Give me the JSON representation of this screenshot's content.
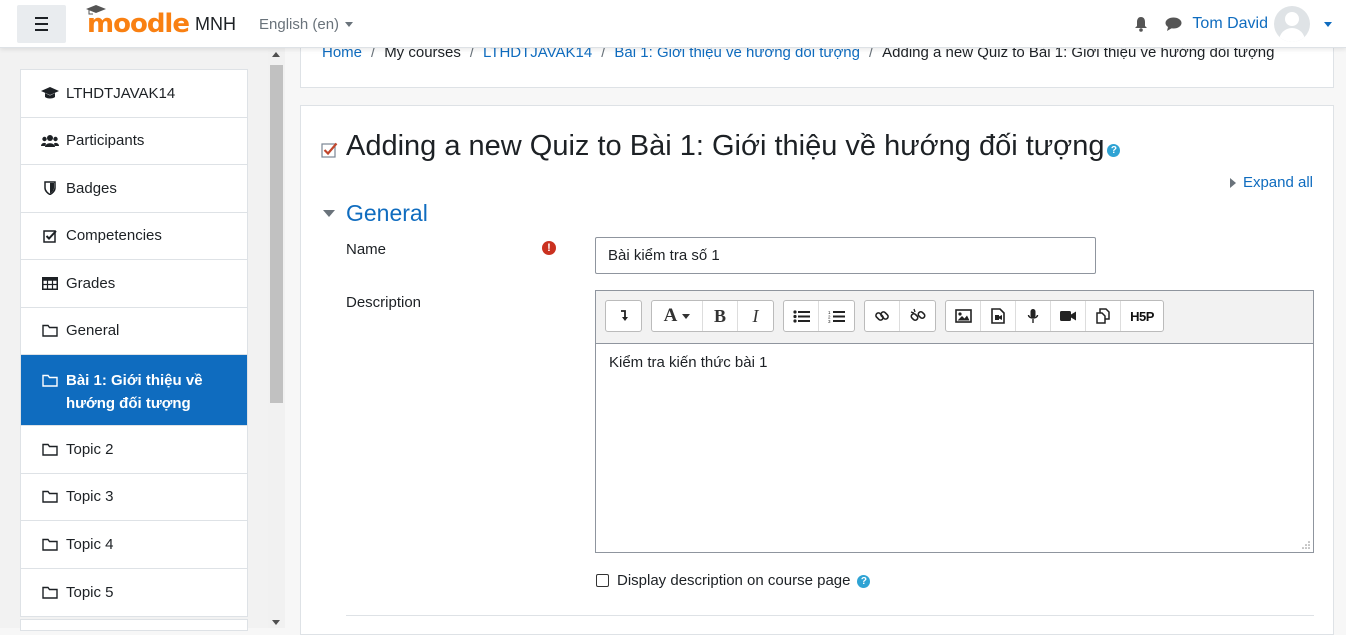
{
  "navbar": {
    "logo_text": "moodle",
    "site_name": "MNH",
    "language": "English (en)",
    "user_name": "Tom David"
  },
  "sidebar": {
    "items": [
      {
        "label": "LTHDTJAVAK14",
        "icon": "graduation-cap-icon"
      },
      {
        "label": "Participants",
        "icon": "users-icon"
      },
      {
        "label": "Badges",
        "icon": "shield-icon"
      },
      {
        "label": "Competencies",
        "icon": "check-square-icon"
      },
      {
        "label": "Grades",
        "icon": "table-icon"
      },
      {
        "label": "General",
        "icon": "folder-icon"
      },
      {
        "label": "Bài 1: Giới thiệu về hướng đối tượng",
        "icon": "folder-icon",
        "active": true
      },
      {
        "label": "Topic 2",
        "icon": "folder-icon"
      },
      {
        "label": "Topic 3",
        "icon": "folder-icon"
      },
      {
        "label": "Topic 4",
        "icon": "folder-icon"
      },
      {
        "label": "Topic 5",
        "icon": "folder-icon"
      }
    ]
  },
  "breadcrumb": {
    "items": [
      "Home",
      "My courses",
      "LTHDTJAVAK14",
      "Bài 1: Giới thiệu về hướng đối tượng"
    ],
    "current": "Adding a new Quiz to Bài 1: Giới thiệu về hướng đối tượng"
  },
  "page": {
    "title": "Adding a new Quiz to Bài 1: Giới thiệu về hướng đối tượng",
    "expand_all": "Expand all",
    "section_general": "General",
    "name_label": "Name",
    "name_value": "Bài kiểm tra số 1",
    "description_label": "Description",
    "description_value": "Kiểm tra kiến thức bài 1",
    "display_description_label": "Display description on course page"
  },
  "colors": {
    "primary": "#0f6cbf",
    "brand": "#f98012",
    "required": "#ca3120",
    "help": "#2fa3d4"
  }
}
